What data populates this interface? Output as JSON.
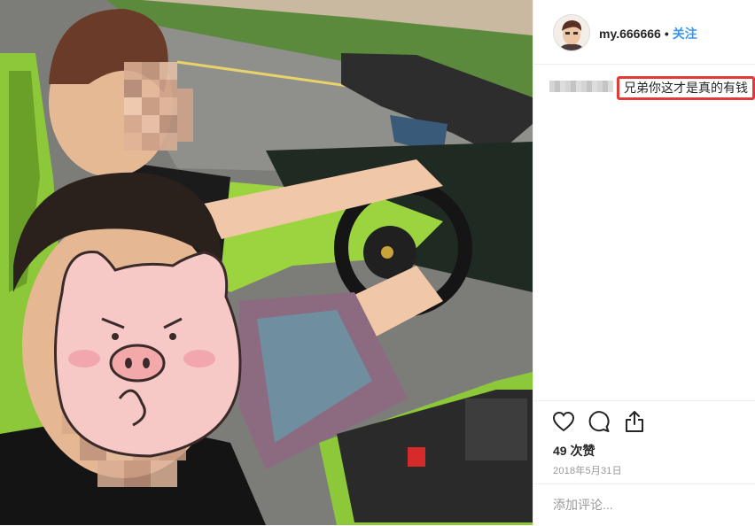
{
  "post": {
    "username": "my.666666",
    "separator": "•",
    "follow_label": "关注",
    "caption": "兄弟你这才是真的有钱",
    "likes_text": "49 次赞",
    "date_text": "2018年5月31日",
    "comment_placeholder": "添加评论..."
  },
  "colors": {
    "follow_blue": "#3897f0",
    "highlight_red": "#e53935",
    "car_green": "#8cc83a"
  },
  "icons": [
    "heart-icon",
    "comment-icon",
    "share-icon"
  ]
}
